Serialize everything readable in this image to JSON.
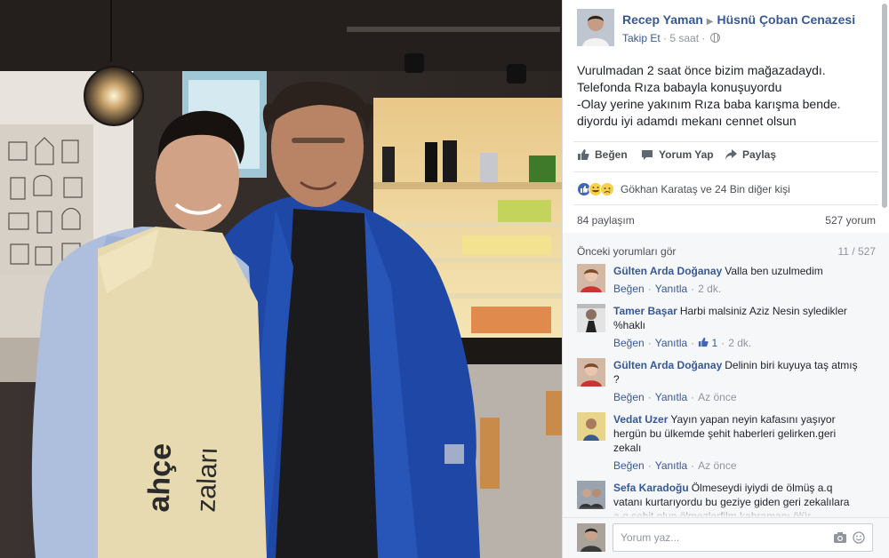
{
  "post": {
    "author": "Recep Yaman",
    "target": "Hüsnü Çoban Cenazesi",
    "follow": "Takip Et",
    "time": "5 saat",
    "lines": [
      "Vurulmadan 2 saat önce bizim mağazadaydı.",
      "Telefonda Rıza babayla konuşuyordu",
      "-Olay yerine yakınım Rıza baba karışma bende.",
      "diyordu iyi adamdı mekanı cennet olsun"
    ]
  },
  "actions": {
    "like": "Beğen",
    "comment": "Yorum Yap",
    "share": "Paylaş"
  },
  "reactions": {
    "text": "Gökhan Karataş ve 24 Bin diğer kişi",
    "icons": [
      "like-reaction",
      "haha-reaction",
      "sad-reaction"
    ]
  },
  "counts": {
    "shares": "84 paylaşım",
    "comments": "527 yorum"
  },
  "previous": {
    "label": "Önceki yorumları gör",
    "progress": "11 / 527"
  },
  "comments": [
    {
      "name": "Gülten Arda Doğanay",
      "text": "Valla ben uzulmedim",
      "like": "Beğen",
      "reply": "Yanıtla",
      "likes": "",
      "time": "2 dk."
    },
    {
      "name": "Tamer Başar",
      "text": "Harbi malsiniz Aziz Nesin syledikler %haklı",
      "like": "Beğen",
      "reply": "Yanıtla",
      "likes": "1",
      "time": "2 dk."
    },
    {
      "name": "Gülten Arda Doğanay",
      "text": "Delinin biri kuyuya taş atmış ?",
      "like": "Beğen",
      "reply": "Yanıtla",
      "likes": "",
      "time": "Az önce"
    },
    {
      "name": "Vedat Uzer",
      "text": "Yayın yapan neyin kafasını yaşıyor hergün bu ülkemde şehit haberleri gelirken.geri zekalı",
      "like": "Beğen",
      "reply": "Yanıtla",
      "likes": "",
      "time": "Az önce"
    },
    {
      "name": "Sefa Karadoğu",
      "text": "Ölmeseydi iyiydi de ölmüş a.q vatanı kurtarıyordu bu geziye giden geri zekalılara a.q şehit olup ölmezlerfilm kahramanı ölür",
      "like": "",
      "reply": "",
      "likes": "",
      "time": ""
    }
  ],
  "composer": {
    "placeholder": "Yorum yaz..."
  },
  "photo": {
    "apron_text_1": "ahçe",
    "apron_text_2": "zaları"
  },
  "colors": {
    "link": "#365899",
    "accent": "#4267b2",
    "muted": "#90949c"
  }
}
